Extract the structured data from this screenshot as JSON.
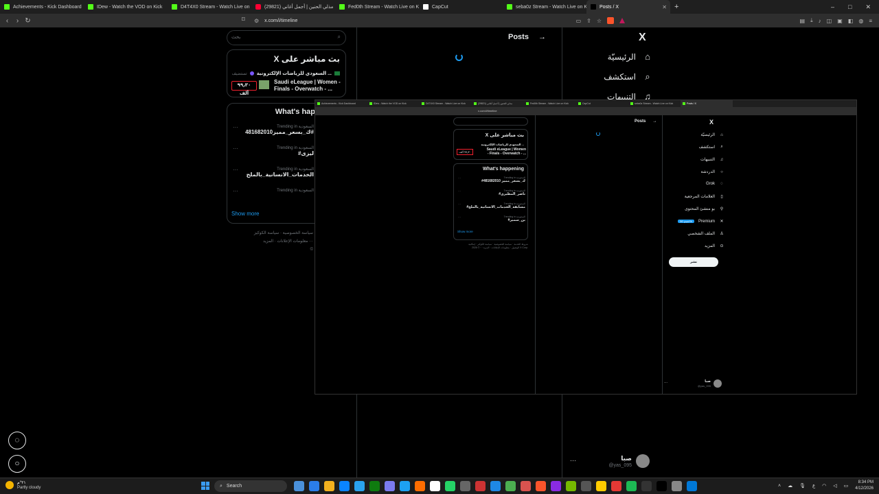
{
  "browser": {
    "tabs": [
      {
        "label": "Achievements - Kick Dashboard",
        "icon": "kick-icon",
        "active": false
      },
      {
        "label": "IDew - Watch the VOD on Kick",
        "icon": "kick-icon",
        "active": false
      },
      {
        "label": "D4T4X0 Stream - Watch Live on Kick",
        "icon": "kick-icon",
        "active": false
      },
      {
        "label": "(29821) مذلي الحنين | أجمل أغاني",
        "icon": "youtube-icon",
        "active": false
      },
      {
        "label": "Fed0th Stream - Watch Live on Kick",
        "icon": "kick-icon",
        "active": false
      },
      {
        "label": "CapCut",
        "icon": "capcut-icon",
        "active": false
      },
      {
        "label": "seba0z Stream - Watch Live on Kick",
        "icon": "kick-icon",
        "active": false
      },
      {
        "label": "Posts / X",
        "icon": "x-icon",
        "active": true
      }
    ],
    "new_tab": "+",
    "url": "x.com/i/timeline",
    "window_controls": [
      "–",
      "□",
      "✕"
    ]
  },
  "x": {
    "logo": "X",
    "nav": [
      {
        "label": "الرئيسيّة",
        "icon": "home-icon",
        "glyph": "⌂"
      },
      {
        "label": "استكشف",
        "icon": "search-icon",
        "glyph": "⌕"
      },
      {
        "label": "التنبيهات",
        "icon": "bell-icon",
        "glyph": "♫"
      }
    ],
    "posts_header": "Posts",
    "posts_arrow": "→",
    "search_placeholder": "بحث",
    "live_card": {
      "title": "X بث مباشر على",
      "league": "السعودي للرياضات الإلكترونية ...",
      "sub": "تستضيف",
      "viewers": "٩٩٫٣٠ ألف",
      "match": "Saudi eLeague | Women - Finals - Overwatch - ..."
    },
    "trends_card": {
      "title": "What's hap",
      "items": [
        {
          "meta": "Trending in السعودية",
          "tag": "481682010ك_بسعر_مميز#"
        },
        {
          "meta": "Trending in السعودية",
          "tag": "#ليزى"
        },
        {
          "meta": "Trending in السعودية",
          "tag": "الخدمات_الانسانية_بالملح"
        },
        {
          "meta": "Trending in السعودية",
          "tag": ""
        }
      ],
      "show_more": "Show more"
    },
    "footer": [
      "سياسة الخصوصية",
      "سياسة الكوكيز",
      "معلومات الإعلانات",
      "المزيد ···",
      "©"
    ],
    "account": {
      "name": "صبا",
      "handle": "@yas_095",
      "more": "···"
    }
  },
  "overlay": {
    "tabs": [
      "Achievements - Kick Dashboard",
      "IDew - Watch the VOD on Kick",
      "D4T4X0 Stream - Watch Live on Kick",
      "(29821) مذلي الحنين | أجمل أغاني",
      "Fed0th Stream - Watch Live on Kick",
      "CapCut",
      "seba0z Stream - Watch Live on Kick",
      "Posts / X"
    ],
    "url": "x.com/i/timeline",
    "posts_header": "Posts",
    "nav": [
      {
        "label": "الرئيسيّة",
        "glyph": "⌂"
      },
      {
        "label": "استكشف",
        "glyph": "⌕"
      },
      {
        "label": "التنبيهات",
        "glyph": "♫"
      },
      {
        "label": "الدردشة",
        "glyph": "○"
      },
      {
        "label": "Grok",
        "glyph": "◌"
      },
      {
        "label": "العلامات المرجعية",
        "glyph": "▯"
      },
      {
        "label": "بو منشئ المحتوى",
        "glyph": "⚲"
      },
      {
        "label": "Premium",
        "glyph": "✕",
        "badge": "خصم 50%"
      },
      {
        "label": "الملف الشخصي",
        "glyph": "♙"
      },
      {
        "label": "المزيد",
        "glyph": "⊙"
      }
    ],
    "post_button": "نشر",
    "live_title": "X بث مباشر على",
    "live_league": "السعودي للرياضات الإلكترونية ...",
    "live_viewers": "٩٩٫٣٠ ألف",
    "live_match": "Saudi eLeague | Women - Finals - Overwatch - ...",
    "trends_title": "What's happening",
    "trends": [
      {
        "meta": "Trending in السعودية",
        "tag": "#ك_بسعر_مميز 481682010"
      },
      {
        "meta": "Trending in السعودية",
        "tag": "#ناصر_المطيري"
      },
      {
        "meta": "Trending in السعودية",
        "tag": "#مسابقة_الخدمات_الانسانية_بالملح"
      },
      {
        "meta": "Trending in السعودية",
        "tag": "#بن_سمير"
      }
    ],
    "show_more": "Show more",
    "footer": "شروط الخدمة · سياسة الخصوصية · سياسة الكوكيز · إمكانية الوصول · معلومات الإعلانات · المزيد ··· © 2026 X Corp.",
    "account": {
      "name": "صبا",
      "handle": "@yas_095"
    }
  },
  "taskbar": {
    "temp": "٢١°م",
    "condition": "Partly cloudy",
    "search_label": "Search",
    "time": "8:34 PM",
    "date": "4/12/2026",
    "lang": "ع",
    "app_colors": [
      "#4a90d9",
      "#2b7de9",
      "#f2b01e",
      "#0a84ff",
      "#2aa3ef",
      "#0f7b0f",
      "#7b7bf0",
      "#1da1f2",
      "#ff6d00",
      "#ffffff",
      "#25d366",
      "#666666",
      "#c33",
      "#1e88e5",
      "#4caf50",
      "#d9534f",
      "#fb542b",
      "#8a2be2",
      "#76b900",
      "#555",
      "#ffcc00",
      "#e53935",
      "#1db954",
      "#333",
      "#000",
      "#888",
      "#0078d7"
    ]
  },
  "colors": {
    "accent": "#1d9bf0",
    "live_border": "#f4212e",
    "bg": "#000000"
  }
}
